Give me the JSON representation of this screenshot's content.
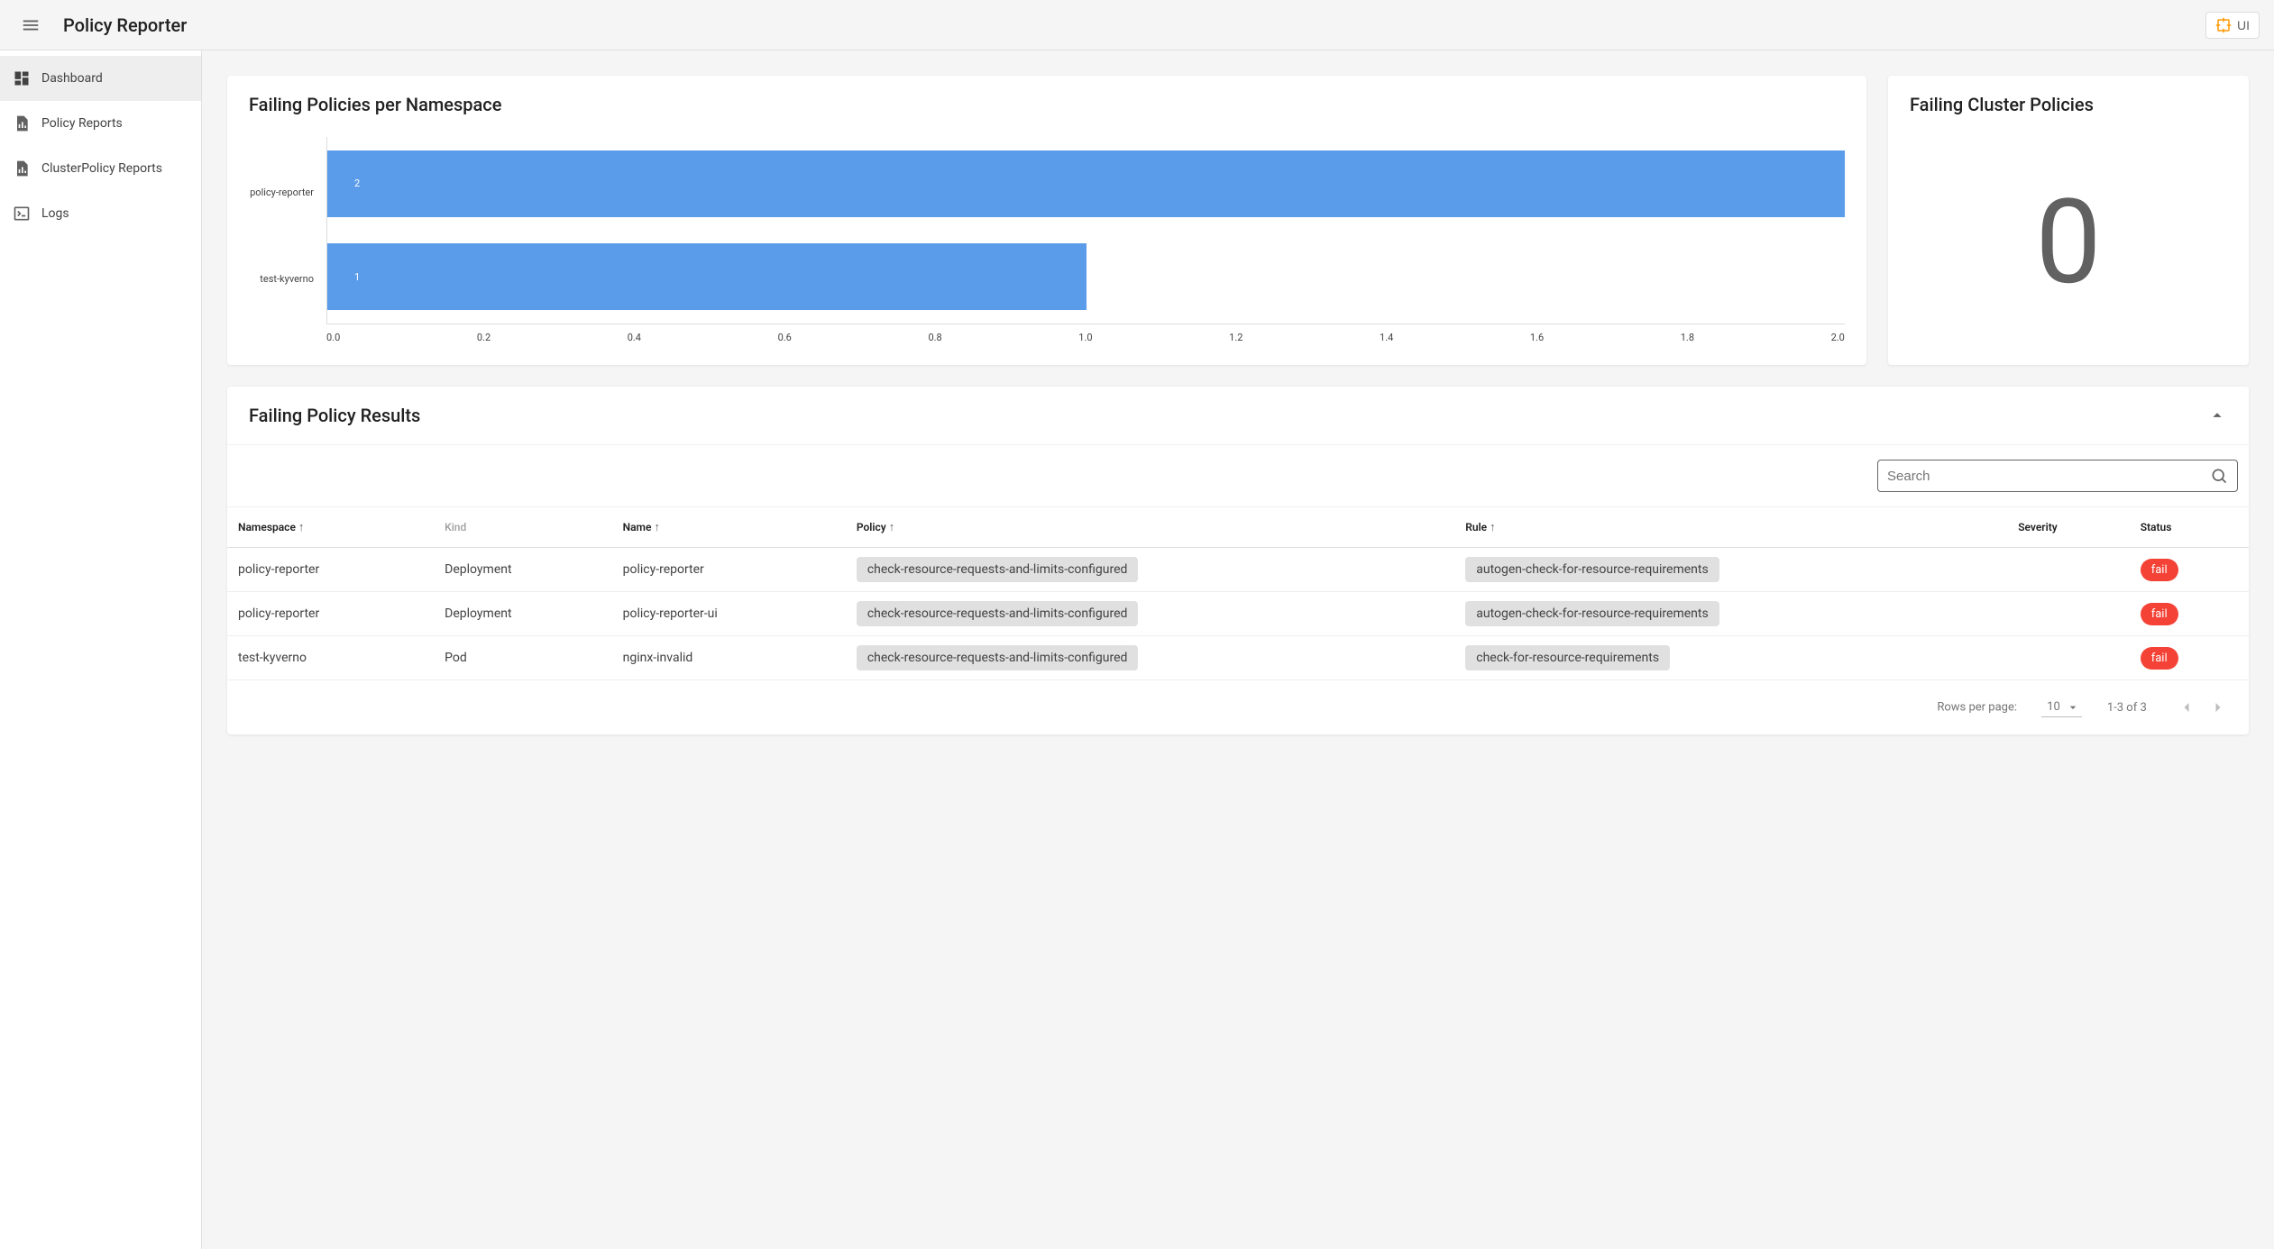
{
  "header": {
    "title": "Policy Reporter",
    "ui_button_label": "UI"
  },
  "sidebar": {
    "items": [
      {
        "label": "Dashboard",
        "icon": "dashboard-icon",
        "active": true
      },
      {
        "label": "Policy Reports",
        "icon": "file-chart-icon",
        "active": false
      },
      {
        "label": "ClusterPolicy Reports",
        "icon": "file-chart-icon",
        "active": false
      },
      {
        "label": "Logs",
        "icon": "terminal-icon",
        "active": false
      }
    ]
  },
  "chart_card": {
    "title": "Failing Policies per Namespace"
  },
  "chart_data": {
    "type": "bar",
    "orientation": "horizontal",
    "categories": [
      "policy-reporter",
      "test-kyverno"
    ],
    "values": [
      2,
      1
    ],
    "xlim": [
      0.0,
      2.0
    ],
    "xticks": [
      "0.0",
      "0.2",
      "0.4",
      "0.6",
      "0.8",
      "1.0",
      "1.2",
      "1.4",
      "1.6",
      "1.8",
      "2.0"
    ],
    "bar_color": "#5a9bea"
  },
  "cluster_card": {
    "title": "Failing Cluster Policies",
    "value": "0"
  },
  "results": {
    "title": "Failing Policy Results",
    "search_placeholder": "Search",
    "columns": {
      "namespace": "Namespace",
      "kind": "Kind",
      "name": "Name",
      "policy": "Policy",
      "rule": "Rule",
      "severity": "Severity",
      "status": "Status"
    },
    "rows": [
      {
        "namespace": "policy-reporter",
        "kind": "Deployment",
        "name": "policy-reporter",
        "policy": "check-resource-requests-and-limits-configured",
        "rule": "autogen-check-for-resource-requirements",
        "severity": "",
        "status": "fail"
      },
      {
        "namespace": "policy-reporter",
        "kind": "Deployment",
        "name": "policy-reporter-ui",
        "policy": "check-resource-requests-and-limits-configured",
        "rule": "autogen-check-for-resource-requirements",
        "severity": "",
        "status": "fail"
      },
      {
        "namespace": "test-kyverno",
        "kind": "Pod",
        "name": "nginx-invalid",
        "policy": "check-resource-requests-and-limits-configured",
        "rule": "check-for-resource-requirements",
        "severity": "",
        "status": "fail"
      }
    ],
    "footer": {
      "rows_per_page_label": "Rows per page:",
      "rows_per_page_value": "10",
      "range_text": "1-3 of 3"
    }
  }
}
